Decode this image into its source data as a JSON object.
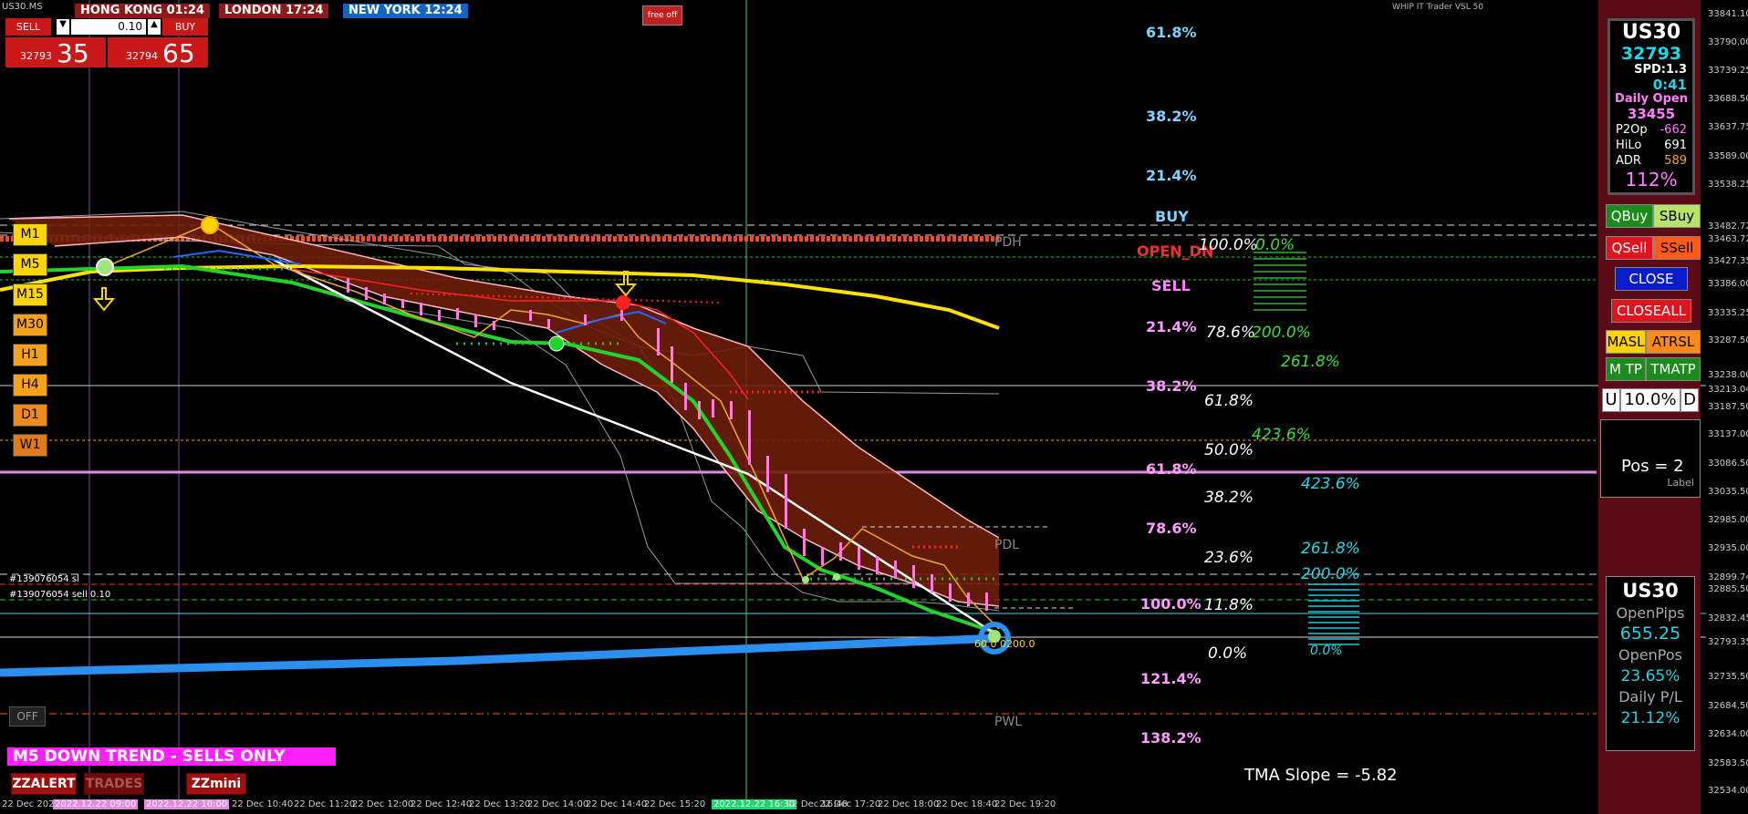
{
  "symbol": "US30.MS",
  "sessions": [
    {
      "label": "HONG KONG 01:24",
      "color": "#8b1a1a"
    },
    {
      "label": "LONDON  17:24",
      "color": "#8b1a1a"
    },
    {
      "label": "NEW YORK 12:24",
      "color": "#1565c0"
    }
  ],
  "trade_panel": {
    "sell_label": "SELL",
    "buy_label": "BUY",
    "lot": "0.10",
    "sell_price_small": "32793",
    "sell_price_big": "35",
    "buy_price_small": "32794",
    "buy_price_big": "65"
  },
  "top_button": "free off",
  "timeframes": [
    "M1",
    "M5",
    "M15",
    "M30",
    "H1",
    "H4",
    "D1",
    "W1"
  ],
  "timeframe_colors": [
    "#ffd400",
    "#ffd400",
    "#ffd400",
    "#f7a11a",
    "#f7a11a",
    "#f7a11a",
    "#f08a1a",
    "#e07b1a"
  ],
  "fib_left": [
    {
      "label": "61.8%",
      "color": "#7fd3ff"
    },
    {
      "label": "38.2%",
      "color": "#7fd3ff"
    },
    {
      "label": "21.4%",
      "color": "#7fd3ff"
    },
    {
      "label": "BUY",
      "color": "#7fd3ff"
    },
    {
      "label": "OPEN_DN",
      "color": "#ff2a2a"
    },
    {
      "label": "SELL",
      "color": "#ff7fff"
    },
    {
      "label": "21.4%",
      "color": "#ff9cff"
    },
    {
      "label": "38.2%",
      "color": "#ff9cff"
    },
    {
      "label": "61.8%",
      "color": "#ff9cff"
    },
    {
      "label": "78.6%",
      "color": "#ff9cff"
    },
    {
      "label": "100.0%",
      "color": "#ff9cff"
    },
    {
      "label": "121.4%",
      "color": "#ff9cff"
    },
    {
      "label": "138.2%",
      "color": "#ff9cff"
    }
  ],
  "fib_white": [
    "100.0%",
    "78.6%",
    "61.8%",
    "50.0%",
    "38.2%",
    "23.6%",
    "11.8%",
    "0.0%"
  ],
  "fib_green": [
    "0.0%",
    "200.0%",
    "261.8%",
    "423.6%"
  ],
  "fib_cyan": [
    "423.6%",
    "261.8%",
    "200.0%",
    "0.0%"
  ],
  "level_tags": {
    "pdh": "PDH",
    "pdl": "PDL",
    "pwl": "PWL"
  },
  "info_panel": {
    "symbol": "US30",
    "price": "32793",
    "spread": "SPD:1.3",
    "timer": "0:41",
    "daily_open_label": "Daily Open",
    "daily_open": "33455",
    "rows": [
      {
        "label": "P2Op",
        "value": "-662"
      },
      {
        "label": "HiLo",
        "value": "691"
      },
      {
        "label": "ADR",
        "value": "589"
      }
    ],
    "percent": "112%"
  },
  "buttons": {
    "qbuy": "QBuy",
    "sbuy": "SBuy",
    "qsell": "QSell",
    "ssell": "SSell",
    "close": "CLOSE",
    "closeall": "CLOSEALL",
    "masl": "MASL",
    "atrsl": "ATRSL",
    "mtp": "M TP",
    "tmatp": "TMATP",
    "u": "U",
    "risk": "10.0%",
    "d": "D"
  },
  "pos_box": {
    "text": "Pos = 2",
    "sub": "Label"
  },
  "pnl_panel": {
    "symbol": "US30",
    "open_pips_label": "OpenPips",
    "open_pips": "655.25",
    "open_pos_label": "OpenPos",
    "open_pos": "23.65%",
    "daily_label": "Daily P/L",
    "daily": "21.12%"
  },
  "trend_banner": "M5  DOWN TREND - SELLS ONLY",
  "bottom_buttons": [
    "ZZALERT",
    "TRADES",
    "ZZmini"
  ],
  "off_button": "OFF",
  "tma_slope": "TMA Slope = -5.82",
  "price_labels": [
    "33841.10",
    "33790.00",
    "33739.25",
    "33688.50",
    "33637.75",
    "33589.00",
    "33538.25",
    "33482.72",
    "33463.72",
    "33427.35",
    "33386.00",
    "33335.25",
    "33287.50",
    "33238.00",
    "33213.04",
    "33187.50",
    "33137.00",
    "33086.50",
    "33035.50",
    "32985.00",
    "32935.00",
    "32899.74",
    "32885.50",
    "32832.45",
    "32793.35",
    "32735.50",
    "32684.50",
    "32634.00",
    "32583.50",
    "32534.00"
  ],
  "time_labels": [
    "22 Dec 2022",
    "2022.12.22 09:00",
    "2022.12.22 10:00",
    "22 Dec 10:40",
    "22 Dec 11:20",
    "22 Dec 12:00",
    "22 Dec 12:40",
    "22 Dec 13:20",
    "22 Dec 14:00",
    "22 Dec 14:40",
    "22 Dec 15:20",
    "2022.12.22 16:30",
    "22 Dec 16:40",
    "22 Dec 17:20",
    "22 Dec 18:00",
    "22 Dec 18:40",
    "22 Dec 19:20"
  ],
  "order_tags": [
    "#139076054 sl",
    "#139076054 sell 0.10"
  ],
  "watermark": "WHIP IT Trader VSL 50",
  "target_label": "60.0 0200.0"
}
